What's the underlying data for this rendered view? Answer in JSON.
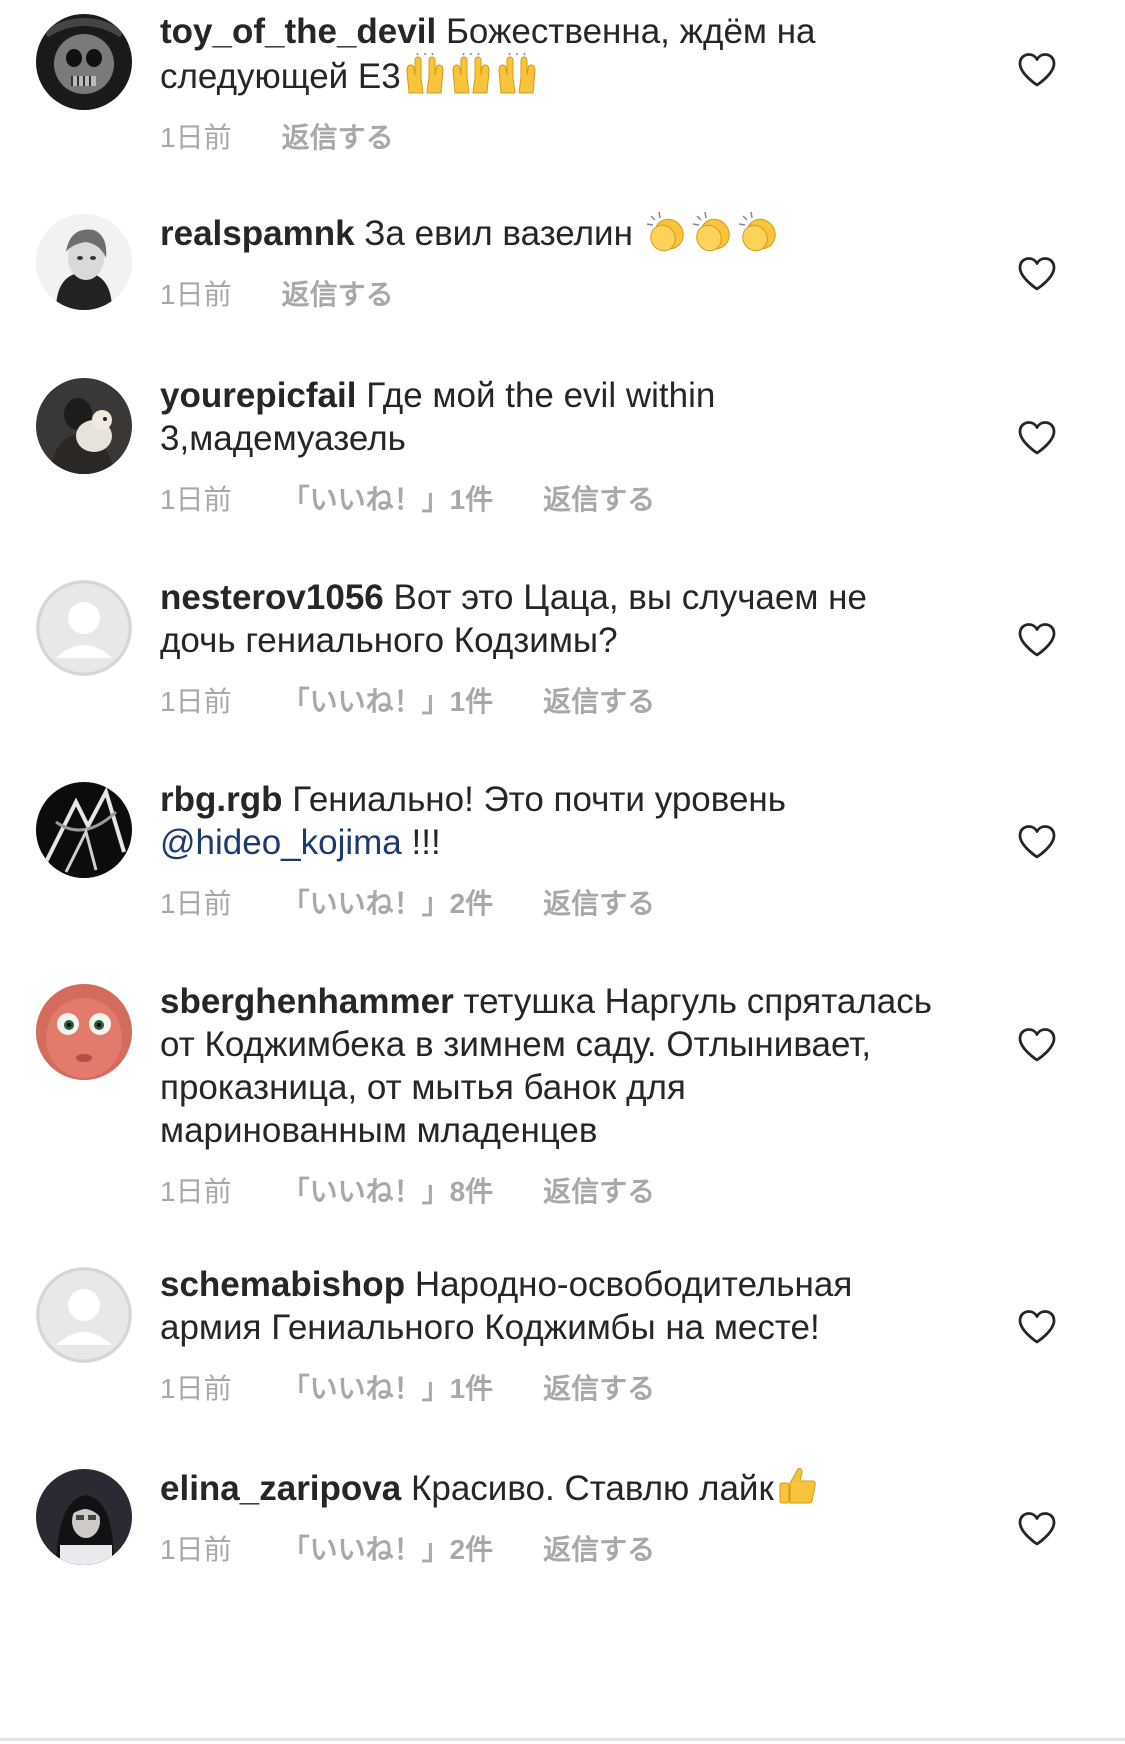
{
  "comments": [
    {
      "username": "toy_of_the_devil",
      "text": "Божественна, ждём на следующей Е3",
      "emoji": "raising-hands",
      "emoji_count": 3,
      "time": "1日前",
      "likes": "",
      "reply": "返信する",
      "avatar": "dark-skull"
    },
    {
      "username": "realspamnk",
      "text": "За евил вазелин ",
      "emoji": "clapping-hands",
      "emoji_count": 3,
      "time": "1日前",
      "likes": "",
      "reply": "返信する",
      "avatar": "woman-bw"
    },
    {
      "username": "yourepicfail",
      "text": "Где мой the evil within 3,мадемуазель",
      "emoji": "",
      "emoji_count": 0,
      "time": "1日前",
      "likes": "「いいね！」1件",
      "reply": "返信する",
      "avatar": "person-dog"
    },
    {
      "username": "nesterov1056",
      "text": "Вот это Цаца, вы случаем не дочь гениального Кодзимы?",
      "emoji": "",
      "emoji_count": 0,
      "time": "1日前",
      "likes": "「いいね！」1件",
      "reply": "返信する",
      "avatar": "default"
    },
    {
      "username": "rbg.rgb",
      "text": "Гениально! Это почти уровень ",
      "mention": "@hideo_kojima",
      "text_after": " !!!",
      "emoji": "",
      "emoji_count": 0,
      "time": "1日前",
      "likes": "「いいね！」2件",
      "reply": "返信する",
      "avatar": "dark-art"
    },
    {
      "username": "sberghenhammer",
      "text": "тетушка Наргуль спряталась от Коджимбека в зимнем саду. Отлынивает, проказница, от мытья банок для маринованным младенцев",
      "emoji": "",
      "emoji_count": 0,
      "time": "1日前",
      "likes": "「いいね！」8件",
      "reply": "返信する",
      "avatar": "red-face"
    },
    {
      "username": "schemabishop",
      "text": "Народно-освободительная армия Гениального Коджимбы на месте!",
      "emoji": "",
      "emoji_count": 0,
      "time": "1日前",
      "likes": "「いいね！」1件",
      "reply": "返信する",
      "avatar": "default"
    },
    {
      "username": "elina_zaripova",
      "text": "Красиво. Ставлю лайк",
      "emoji": "thumbs-up",
      "emoji_count": 1,
      "time": "1日前",
      "likes": "「いいね！」2件",
      "reply": "返信する",
      "avatar": "girl-dark"
    }
  ],
  "icons": {
    "like": "heart-outline-icon"
  },
  "colors": {
    "text": "#262626",
    "meta": "#a8a8a8",
    "mention": "#1f3a70",
    "heart": "#262626"
  }
}
